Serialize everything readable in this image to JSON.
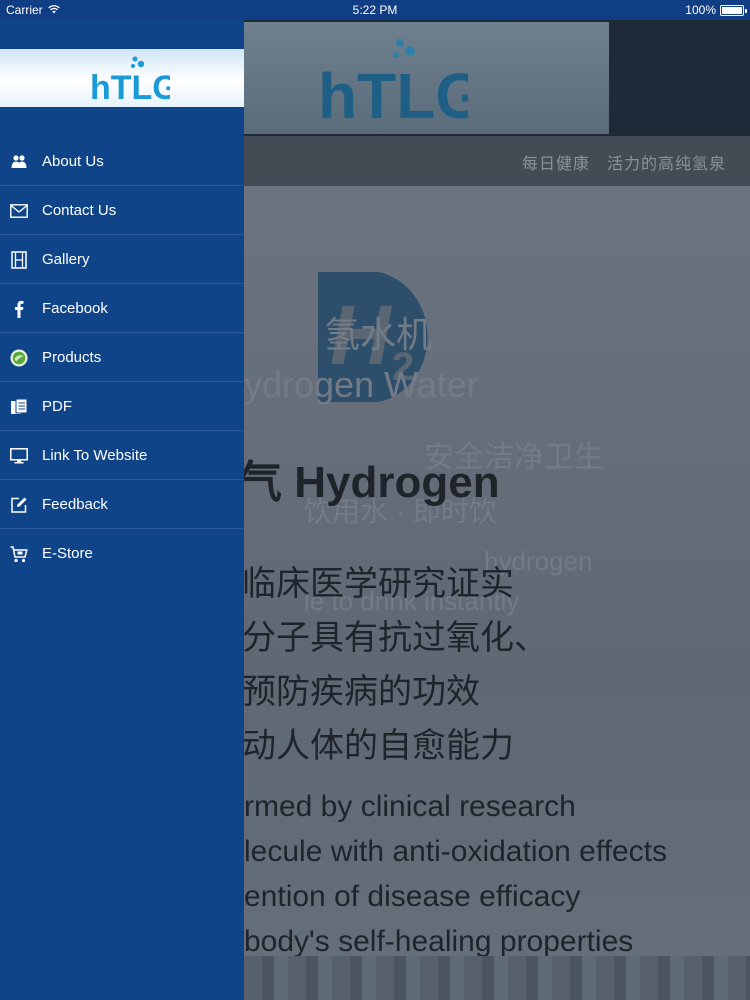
{
  "status_bar": {
    "carrier": "Carrier",
    "time": "5:22 PM",
    "battery": "100%"
  },
  "drawer": {
    "logo_text": "hTLG",
    "items": [
      {
        "label": "About Us",
        "icon": "people-icon"
      },
      {
        "label": "Contact Us",
        "icon": "envelope-icon"
      },
      {
        "label": "Gallery",
        "icon": "film-icon"
      },
      {
        "label": "Facebook",
        "icon": "facebook-icon"
      },
      {
        "label": "Products",
        "icon": "products-icon"
      },
      {
        "label": "PDF",
        "icon": "documents-icon"
      },
      {
        "label": "Link To Website",
        "icon": "monitor-icon"
      },
      {
        "label": "Feedback",
        "icon": "edit-icon"
      },
      {
        "label": "E-Store",
        "icon": "cart-icon"
      }
    ]
  },
  "main": {
    "logo_text": "hTLG",
    "slogan": "每日健康　活力的高纯氢泉",
    "poster": {
      "headline": "气 Hydrogen",
      "cn_lines": [
        "临床医学研究证实",
        "分子具有抗过氧化、",
        "预防疾病的功效",
        "动人体的自愈能力"
      ],
      "en_lines": [
        "rmed by clinical research",
        "lecule with anti-oxidation effects",
        "ention of disease efficacy",
        "body's self-healing properties"
      ]
    }
  },
  "colors": {
    "drawer_bg": "#0f4489",
    "status_bg": "#0f3e84",
    "logo_blue": "#1a9ad6"
  }
}
